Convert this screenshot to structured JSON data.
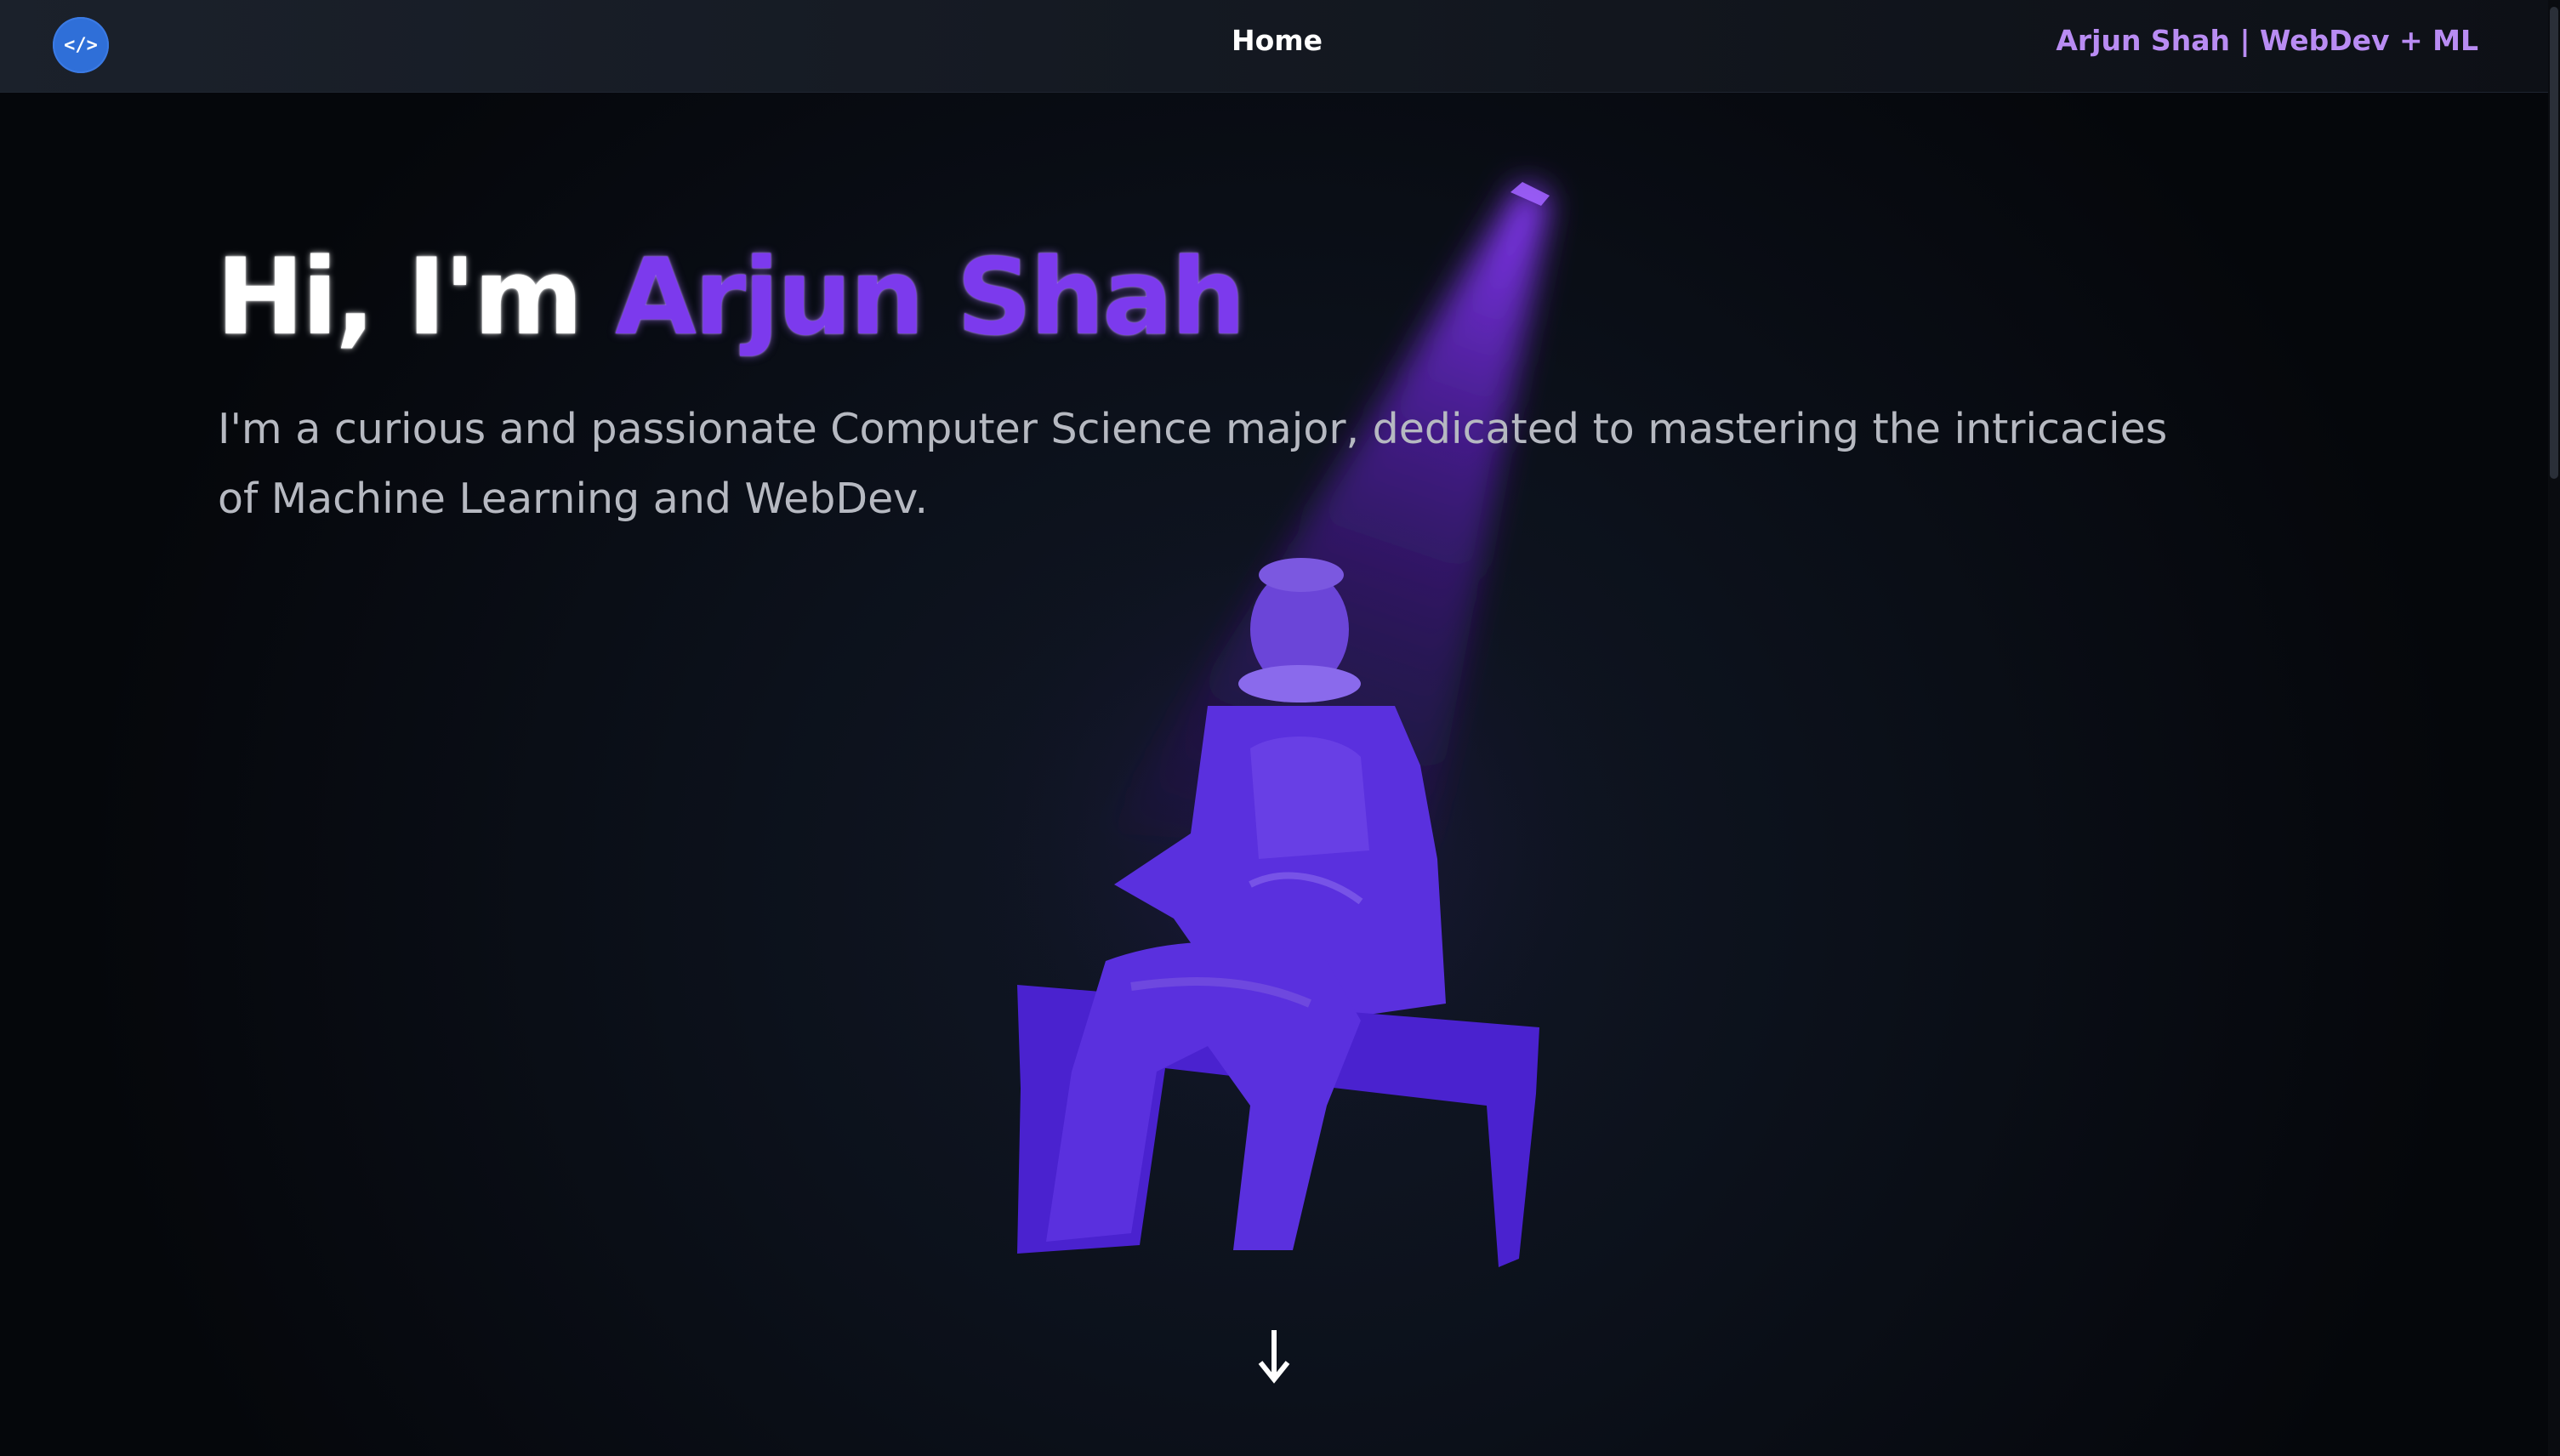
{
  "navbar": {
    "logo_text": "</>",
    "home_label": "Home",
    "brand_text": "Arjun Shah | WebDev + ML"
  },
  "hero": {
    "greeting": "Hi, I'm ",
    "name": "Arjun Shah",
    "description": "I'm a curious and passionate Computer Science major, dedicated to mastering the intricacies of Machine Learning and WebDev."
  },
  "icons": {
    "logo": "code-icon",
    "scroll": "arrow-down-icon"
  },
  "colors": {
    "accent": "#7c3aed",
    "brand_text": "#b98cf3",
    "logo_bg": "#2f6fd8",
    "background": "#05070b"
  }
}
